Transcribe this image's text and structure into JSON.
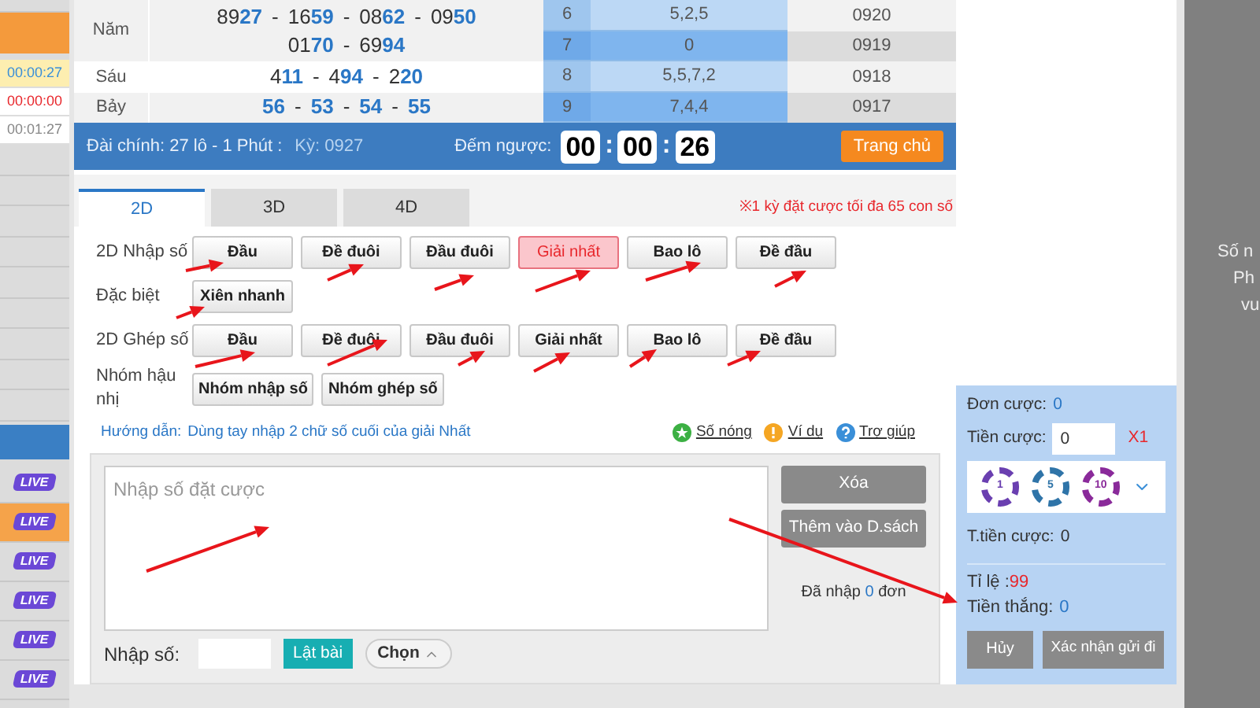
{
  "sidebar": {
    "timers": [
      {
        "time": "00:00:27",
        "color": "#3a8fd8",
        "selected": true
      },
      {
        "time": "00:00:00",
        "color": "#e8272c",
        "selected": false
      },
      {
        "time": "00:01:27",
        "color": "#888888",
        "selected": false
      }
    ],
    "live_items": [
      {
        "label": "LIVE",
        "selected": false
      },
      {
        "label": "LIVE",
        "selected": true
      },
      {
        "label": "LIVE",
        "selected": false
      },
      {
        "label": "LIVE",
        "selected": false
      },
      {
        "label": "LIVE",
        "selected": false
      },
      {
        "label": "LIVE",
        "selected": false
      }
    ]
  },
  "results": [
    {
      "label": "Năm",
      "lines": [
        [
          {
            "head": "89",
            "tail": "27"
          },
          {
            "head": "16",
            "tail": "59"
          },
          {
            "head": "08",
            "tail": "62"
          },
          {
            "head": "09",
            "tail": "50"
          }
        ],
        [
          {
            "head": "01",
            "tail": "70"
          },
          {
            "head": "69",
            "tail": "94"
          }
        ]
      ]
    },
    {
      "label": "Sáu",
      "lines": [
        [
          {
            "head": "4",
            "tail": "11"
          },
          {
            "head": "4",
            "tail": "94"
          },
          {
            "head": "2",
            "tail": "20"
          }
        ]
      ]
    },
    {
      "label": "Bảy",
      "lines": [
        [
          {
            "tail": "56"
          },
          {
            "tail": "53"
          },
          {
            "tail": "54"
          },
          {
            "tail": "55"
          }
        ]
      ]
    }
  ],
  "results_separator": "-",
  "history": [
    {
      "index": "6",
      "digits": "5,2,5",
      "period": "0920"
    },
    {
      "index": "7",
      "digits": "0",
      "period": "0919"
    },
    {
      "index": "8",
      "digits": "5,5,7,2",
      "period": "0918"
    },
    {
      "index": "9",
      "digits": "7,4,4",
      "period": "0917"
    }
  ],
  "info_bar": {
    "main_label": "Đài chính: 27 lô - 1 Phút :",
    "period": "Kỳ: 0927",
    "countdown_label": "Đếm ngược:",
    "countdown": [
      {
        "kind": "digits",
        "text": "00"
      },
      {
        "kind": "colon",
        "text": ":"
      },
      {
        "kind": "digits",
        "text": "00"
      },
      {
        "kind": "colon",
        "text": ":"
      },
      {
        "kind": "digits",
        "text": "26"
      }
    ],
    "home_button": "Trang chủ"
  },
  "tabs": [
    {
      "label": "2D",
      "selected": true
    },
    {
      "label": "3D",
      "selected": false
    },
    {
      "label": "4D",
      "selected": false
    }
  ],
  "notice": "※1 kỳ đặt cược tối đa 65 con số",
  "bet_rows": [
    {
      "label": "2D Nhập số",
      "buttons": [
        {
          "label": "Đầu",
          "selected": false
        },
        {
          "label": "Đề đuôi",
          "selected": false
        },
        {
          "label": "Đầu đuôi",
          "selected": false
        },
        {
          "label": "Giải nhất",
          "selected": true
        },
        {
          "label": "Bao lô",
          "selected": false
        },
        {
          "label": "Đề đầu",
          "selected": false
        }
      ]
    },
    {
      "label": "Đặc biệt",
      "buttons": [
        {
          "label": "Xiên nhanh",
          "selected": false
        }
      ]
    },
    {
      "label": "2D Ghép số",
      "buttons": [
        {
          "label": "Đầu",
          "selected": false
        },
        {
          "label": "Đề đuôi",
          "selected": false
        },
        {
          "label": "Đầu đuôi",
          "selected": false
        },
        {
          "label": "Giải nhất",
          "selected": false
        },
        {
          "label": "Bao lô",
          "selected": false
        },
        {
          "label": "Đề đầu",
          "selected": false
        }
      ]
    },
    {
      "label": "Nhóm hậu nhị",
      "buttons": [
        {
          "label": "Nhóm nhập số",
          "selected": false
        },
        {
          "label": "Nhóm ghép số",
          "selected": false
        }
      ]
    }
  ],
  "guide": {
    "label": "Hướng dẫn:",
    "text": "Dùng tay nhập 2 chữ số cuối của giải Nhất"
  },
  "links": [
    {
      "kind": "hot",
      "label": "Số nóng"
    },
    {
      "kind": "example",
      "label": "Ví dụ"
    },
    {
      "kind": "help",
      "label": "Trợ giúp"
    }
  ],
  "entry": {
    "placeholder": "Nhập số đặt cược"
  },
  "actions": [
    "Xóa",
    "Thêm vào D.sách"
  ],
  "entered": {
    "before": "Đã nhập",
    "count": "0",
    "after": "đơn"
  },
  "number_entry": {
    "label": "Nhập số:",
    "flip_button": "Lật bài",
    "choose_button": "Chọn"
  },
  "bet_panel": {
    "order_label": "Đơn cược:",
    "order_count": "0",
    "stake_label": "Tiền cược:",
    "stake_value": "0",
    "multiplier": "X1",
    "chips": [
      {
        "value": "1",
        "color": "#6a3fb0"
      },
      {
        "value": "5",
        "color": "#2f74a8"
      },
      {
        "value": "10",
        "color": "#8a2a9a"
      }
    ],
    "total_label": "T.tiền cược:",
    "total_value": "0",
    "odds_label": "Tỉ lệ :",
    "odds_value": "99",
    "win_label": "Tiền thắng:",
    "win_value": "0",
    "cancel": "Hủy",
    "confirm": "Xác nhận gửi đi"
  },
  "side_notice": [
    "Số n",
    "Ph",
    "vu"
  ]
}
